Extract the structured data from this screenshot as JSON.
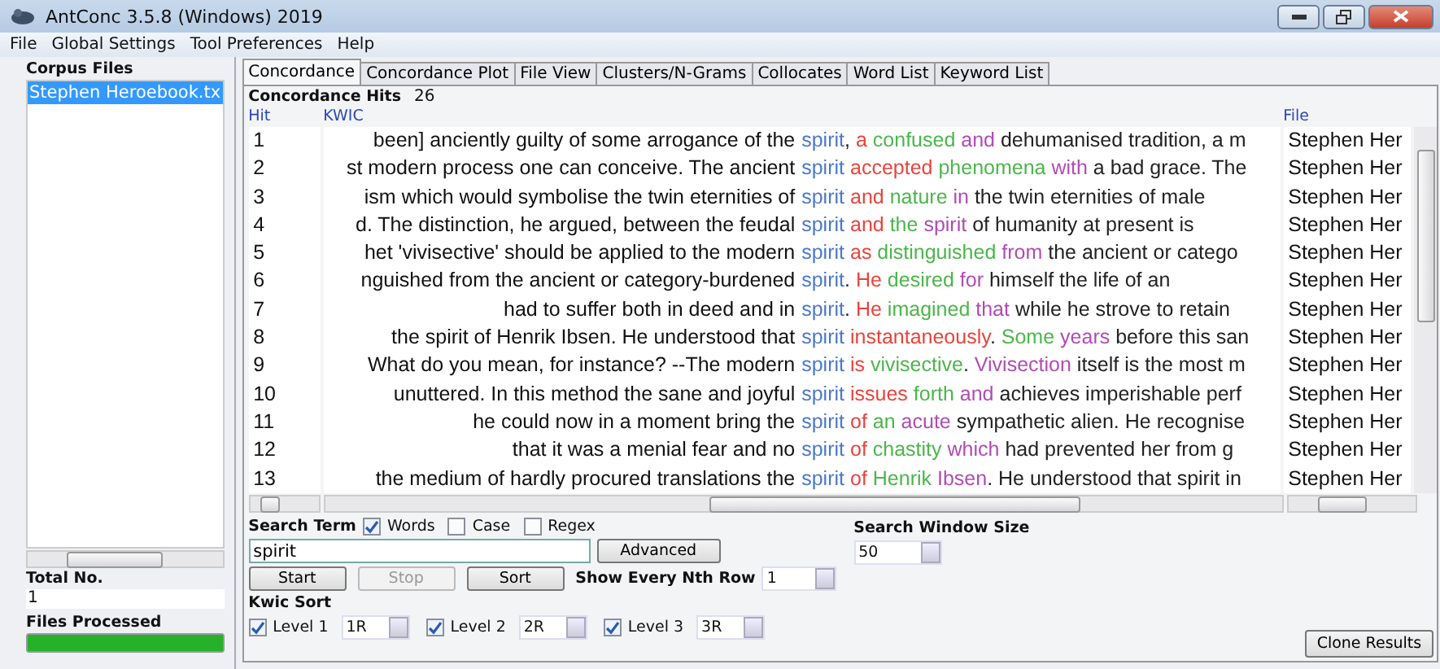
{
  "window": {
    "title": "AntConc 3.5.8 (Windows) 2019"
  },
  "menu": [
    "File",
    "Global Settings",
    "Tool Preferences",
    "Help"
  ],
  "sidebar": {
    "title": "Corpus Files",
    "files": [
      {
        "name": "Stephen Heroebook.tx",
        "selected": true
      }
    ],
    "total_label": "Total No.",
    "total": "1",
    "processed_label": "Files Processed",
    "progress": {
      "level": 1
    }
  },
  "tabs": [
    {
      "label": "Concordance",
      "selected": true
    },
    {
      "label": "Concordance Plot",
      "selected": false
    },
    {
      "label": "File View",
      "selected": false
    },
    {
      "label": "Clusters/N-Grams",
      "selected": false
    },
    {
      "label": "Collocates",
      "selected": false
    },
    {
      "label": "Word List",
      "selected": false
    },
    {
      "label": "Keyword List",
      "selected": false
    }
  ],
  "hits": {
    "label": "Concordance Hits",
    "count": "26"
  },
  "table": {
    "columns": [
      "Hit",
      "KWIC",
      "File"
    ],
    "rows": [
      {
        "hit": "1",
        "left": "been] anciently guilty of some arrogance of the",
        "right": [
          {
            "text": "spirit",
            "kind": "hit"
          },
          {
            "text": ",",
            "kind": "plain"
          },
          {
            "text": " a",
            "kind": "r1"
          },
          {
            "text": " confused",
            "kind": "r2"
          },
          {
            "text": " and",
            "kind": "r3"
          },
          {
            "text": " dehumanised tradition, a m",
            "kind": "plain"
          }
        ],
        "file": "Stephen Her"
      },
      {
        "hit": "2",
        "left": "st modern process one can conceive. The ancient",
        "right": [
          {
            "text": "spirit",
            "kind": "hit"
          },
          {
            "text": " accepted",
            "kind": "r1"
          },
          {
            "text": " phenomena",
            "kind": "r2"
          },
          {
            "text": " with",
            "kind": "r3"
          },
          {
            "text": " a bad grace. The",
            "kind": "plain"
          }
        ],
        "file": "Stephen Her"
      },
      {
        "hit": "3",
        "left": "ism which would symbolise the twin eternities of",
        "right": [
          {
            "text": "spirit",
            "kind": "hit"
          },
          {
            "text": " and",
            "kind": "r1"
          },
          {
            "text": " nature",
            "kind": "r2"
          },
          {
            "text": " in",
            "kind": "r3"
          },
          {
            "text": " the twin eternities of male",
            "kind": "plain"
          }
        ],
        "file": "Stephen Her"
      },
      {
        "hit": "4",
        "left": "d. The distinction, he argued, between the feudal",
        "right": [
          {
            "text": "spirit",
            "kind": "hit"
          },
          {
            "text": " and",
            "kind": "r1"
          },
          {
            "text": " the",
            "kind": "r2"
          },
          {
            "text": " spirit",
            "kind": "r3"
          },
          {
            "text": " of humanity at present is",
            "kind": "plain"
          }
        ],
        "file": "Stephen Her"
      },
      {
        "hit": "5",
        "left": "het 'vivisective' should be applied to the modern",
        "right": [
          {
            "text": "spirit",
            "kind": "hit"
          },
          {
            "text": " as",
            "kind": "r1"
          },
          {
            "text": " distinguished",
            "kind": "r2"
          },
          {
            "text": " from",
            "kind": "r3"
          },
          {
            "text": " the ancient or catego",
            "kind": "plain"
          }
        ],
        "file": "Stephen Her"
      },
      {
        "hit": "6",
        "left": "nguished from the ancient or category-burdened",
        "right": [
          {
            "text": "spirit",
            "kind": "hit"
          },
          {
            "text": ".",
            "kind": "plain"
          },
          {
            "text": " He",
            "kind": "r1"
          },
          {
            "text": " desired",
            "kind": "r2"
          },
          {
            "text": " for",
            "kind": "r3"
          },
          {
            "text": " himself the life of an",
            "kind": "plain"
          }
        ],
        "file": "Stephen Her"
      },
      {
        "hit": "7",
        "left": "had to suffer both in deed and in",
        "right": [
          {
            "text": "spirit",
            "kind": "hit"
          },
          {
            "text": ".",
            "kind": "plain"
          },
          {
            "text": " He",
            "kind": "r1"
          },
          {
            "text": " imagined",
            "kind": "r2"
          },
          {
            "text": " that",
            "kind": "r3"
          },
          {
            "text": " while he strove to retain",
            "kind": "plain"
          }
        ],
        "file": "Stephen Her"
      },
      {
        "hit": "8",
        "left": "the spirit of Henrik Ibsen. He understood that",
        "right": [
          {
            "text": "spirit",
            "kind": "hit"
          },
          {
            "text": " instantaneously",
            "kind": "r1"
          },
          {
            "text": ".",
            "kind": "plain"
          },
          {
            "text": " Some",
            "kind": "r2"
          },
          {
            "text": " years",
            "kind": "r3"
          },
          {
            "text": " before this san",
            "kind": "plain"
          }
        ],
        "file": "Stephen Her"
      },
      {
        "hit": "9",
        "left": "What do you mean, for instance?   --The modern",
        "right": [
          {
            "text": "spirit",
            "kind": "hit"
          },
          {
            "text": " is",
            "kind": "r1"
          },
          {
            "text": " vivisective",
            "kind": "r2"
          },
          {
            "text": ".",
            "kind": "plain"
          },
          {
            "text": " Vivisection",
            "kind": "r3"
          },
          {
            "text": " itself is the most m",
            "kind": "plain"
          }
        ],
        "file": "Stephen Her"
      },
      {
        "hit": "10",
        "left": "unuttered. In this method the sane and joyful",
        "right": [
          {
            "text": "spirit",
            "kind": "hit"
          },
          {
            "text": " issues",
            "kind": "r1"
          },
          {
            "text": " forth",
            "kind": "r2"
          },
          {
            "text": " and",
            "kind": "r3"
          },
          {
            "text": " achieves imperishable perf",
            "kind": "plain"
          }
        ],
        "file": "Stephen Her"
      },
      {
        "hit": "11",
        "left": "he could now in a moment bring the",
        "right": [
          {
            "text": "spirit",
            "kind": "hit"
          },
          {
            "text": " of",
            "kind": "r1"
          },
          {
            "text": " an",
            "kind": "r2"
          },
          {
            "text": " acute",
            "kind": "r3"
          },
          {
            "text": " sympathetic alien. He recognise",
            "kind": "plain"
          }
        ],
        "file": "Stephen Her"
      },
      {
        "hit": "12",
        "left": "that it was a menial fear and no",
        "right": [
          {
            "text": "spirit",
            "kind": "hit"
          },
          {
            "text": " of",
            "kind": "r1"
          },
          {
            "text": " chastity",
            "kind": "r2"
          },
          {
            "text": " which",
            "kind": "r3"
          },
          {
            "text": " had prevented her from g",
            "kind": "plain"
          }
        ],
        "file": "Stephen Her"
      },
      {
        "hit": "13",
        "left": "the medium of hardly procured translations the",
        "right": [
          {
            "text": "spirit",
            "kind": "hit"
          },
          {
            "text": " of",
            "kind": "r1"
          },
          {
            "text": " Henrik",
            "kind": "r2"
          },
          {
            "text": " Ibsen",
            "kind": "r3"
          },
          {
            "text": ". He understood that spirit in",
            "kind": "plain"
          }
        ],
        "file": "Stephen Her"
      }
    ]
  },
  "search": {
    "label": "Search Term",
    "options": [
      {
        "label": "Words",
        "checked": true
      },
      {
        "label": "Case",
        "checked": false
      },
      {
        "label": "Regex",
        "checked": false
      }
    ],
    "value": "spirit",
    "advanced": "Advanced"
  },
  "actions": [
    {
      "label": "Start",
      "disabled": false
    },
    {
      "label": "Stop",
      "disabled": true
    },
    {
      "label": "Sort",
      "disabled": false
    }
  ],
  "nth_row": {
    "label": "Show Every Nth Row",
    "value": "1"
  },
  "window_size": {
    "label": "Search Window Size",
    "value": "50"
  },
  "kwic_sort": {
    "label": "Kwic Sort",
    "levels": [
      {
        "label": "Level 1",
        "checked": true,
        "value": "1R"
      },
      {
        "label": "Level 2",
        "checked": true,
        "value": "2R"
      },
      {
        "label": "Level 3",
        "checked": true,
        "value": "3R"
      }
    ]
  },
  "clone": "Clone Results"
}
